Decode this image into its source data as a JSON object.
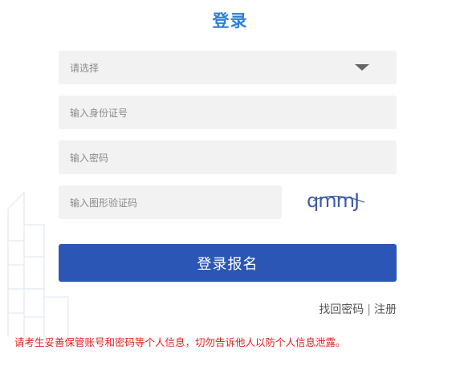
{
  "title": "登录",
  "form": {
    "select_placeholder": "请选择",
    "idcard_placeholder": "输入身份证号",
    "password_placeholder": "输入密码",
    "captcha_placeholder": "输入图形验证码",
    "captcha_text": "qmmJ"
  },
  "login_button": "登录报名",
  "links": {
    "forgot": "找回密码",
    "separator": "|",
    "register": "注册"
  },
  "notice": "请考生妥善保管账号和密码等个人信息，切勿告诉他人以防个人信息泄露。",
  "colors": {
    "title": "#2f7fd6",
    "button": "#2b56b5",
    "notice": "#e02020",
    "field_bg": "#f2f2f2"
  }
}
